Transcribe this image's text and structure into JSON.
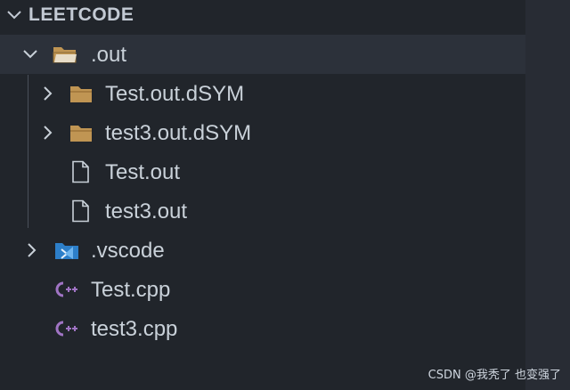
{
  "explorer": {
    "title": "LEETCODE",
    "title_chevron_icon": "chevron-down-icon"
  },
  "tree": {
    "out_folder": {
      "label": ".out",
      "expanded": true,
      "icon": "folder-open-icon",
      "chevron_icon": "chevron-down-icon"
    },
    "test_dsym": {
      "label": "Test.out.dSYM",
      "icon": "folder-icon",
      "chevron_icon": "chevron-right-icon"
    },
    "test3_dsym": {
      "label": "test3.out.dSYM",
      "icon": "folder-icon",
      "chevron_icon": "chevron-right-icon"
    },
    "test_out": {
      "label": "Test.out",
      "icon": "file-icon"
    },
    "test3_out": {
      "label": "test3.out",
      "icon": "file-icon"
    },
    "vscode_folder": {
      "label": ".vscode",
      "icon": "vscode-folder-icon",
      "chevron_icon": "chevron-right-icon"
    },
    "test_cpp": {
      "label": "Test.cpp",
      "icon": "cpp-file-icon"
    },
    "test3_cpp": {
      "label": "test3.cpp",
      "icon": "cpp-file-icon"
    }
  },
  "watermark": {
    "text": "CSDN @我秃了 也变强了"
  },
  "colors": {
    "background": "#21252b",
    "selected_row": "#2c313a",
    "folder": "#c09553",
    "cpp_icon": "#a074c4",
    "vscode_icon": "#2d7fc9",
    "text": "#c9d1d9"
  }
}
